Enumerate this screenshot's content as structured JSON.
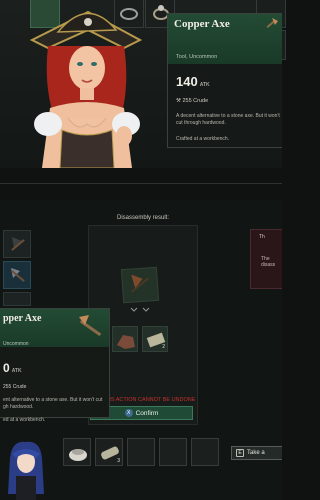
{
  "top_card": {
    "title": "Copper Axe",
    "subtitle": "Tool, Uncommon",
    "atk_value": "140",
    "atk_unit": "ATK",
    "material": "255 Crude",
    "description": "A decent alternative to a stone axe. But it won't cut through hardwood.",
    "crafted": "Crafted at a workbench."
  },
  "disassembly": {
    "label": "Disassembly result:",
    "warning": "THIS ACTION CANNOT BE UNDONE",
    "confirm_label": "Confirm",
    "confirm_key": "X",
    "results": [
      {
        "name": "crude-copper",
        "qty": ""
      },
      {
        "name": "wood-plank",
        "qty": "2"
      }
    ]
  },
  "bottom_card": {
    "title": "pper Axe",
    "subtitle": "Uncommon",
    "atk_value": "0",
    "atk_unit": "ATK",
    "material": "255 Crude",
    "description": "ent alternative to a stone axe. But it won't cut gh hardwood.",
    "crafted": "ed at a workbench."
  },
  "right_panel": {
    "line1": "Th",
    "line2": "The disass"
  },
  "hotbar": {
    "slots": [
      {
        "name": "ore-bag",
        "qty": ""
      },
      {
        "name": "wood-log",
        "qty": "3"
      },
      {
        "name": "empty",
        "qty": ""
      },
      {
        "name": "empty",
        "qty": ""
      },
      {
        "name": "empty",
        "qty": ""
      }
    ]
  },
  "take_button": {
    "key": "E",
    "label": "Take a"
  },
  "colors": {
    "accent_green": "#234b34",
    "warning_red": "#c4322c",
    "confirm_green": "#1f4a36"
  }
}
